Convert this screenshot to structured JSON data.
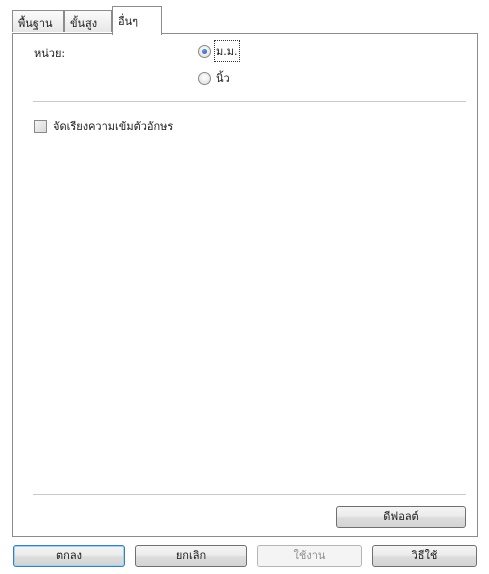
{
  "tabs": [
    {
      "label": "พื้นฐาน"
    },
    {
      "label": "ขั้นสูง"
    },
    {
      "label": "อื่นๆ"
    }
  ],
  "units": {
    "label": "หน่วย:",
    "options": [
      {
        "label": "ม.ม.",
        "selected": true
      },
      {
        "label": "นิ้ว",
        "selected": false
      }
    ]
  },
  "font_smoothing": {
    "label": "จัดเรียงความเข้มตัวอักษร",
    "checked": false
  },
  "panel": {
    "default_button": "ดีฟอลต์"
  },
  "footer": {
    "ok": "ตกลง",
    "cancel": "ยกเลิก",
    "apply": "ใช้งาน",
    "help": "วิธีใช้"
  }
}
